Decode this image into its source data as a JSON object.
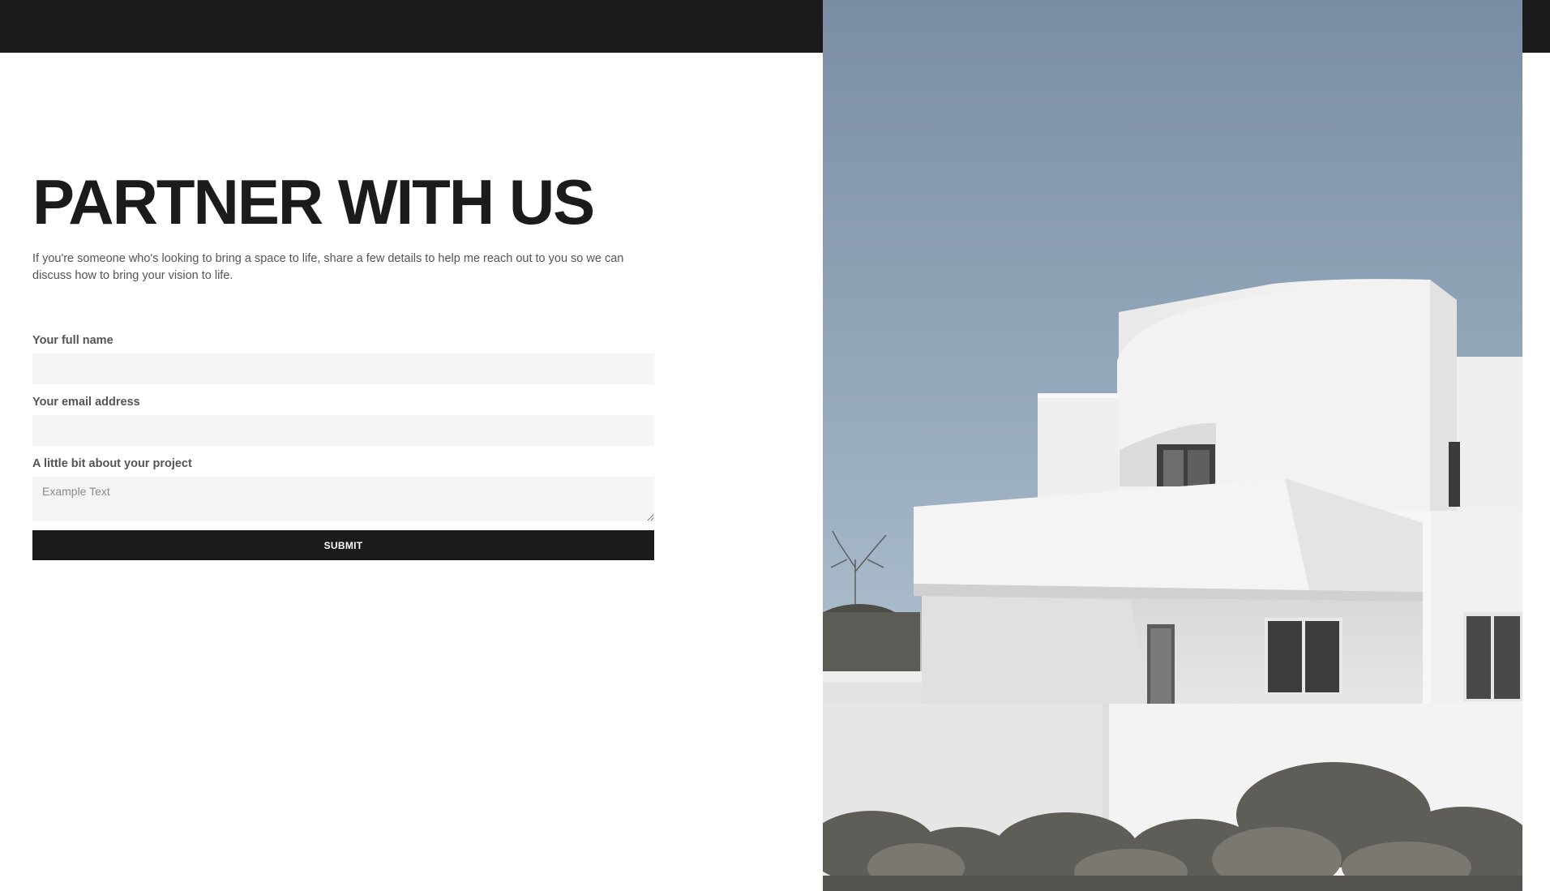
{
  "page": {
    "title": "PARTNER WITH US",
    "intro": "If you're someone who's looking to bring a space to life, share a few details to help me reach out to you so we can discuss how to bring your vision to life."
  },
  "form": {
    "name_label": "Your full name",
    "email_label": "Your email address",
    "project_label": "A little bit about your project",
    "project_placeholder": "Example Text",
    "submit_label": "SUBMIT"
  },
  "colors": {
    "top_bar": "#1b1b1b",
    "button": "#1b1b1b",
    "input_bg": "#f5f5f5",
    "sky": "#8ea3b6"
  },
  "image": {
    "subject": "white modern architecture house"
  }
}
